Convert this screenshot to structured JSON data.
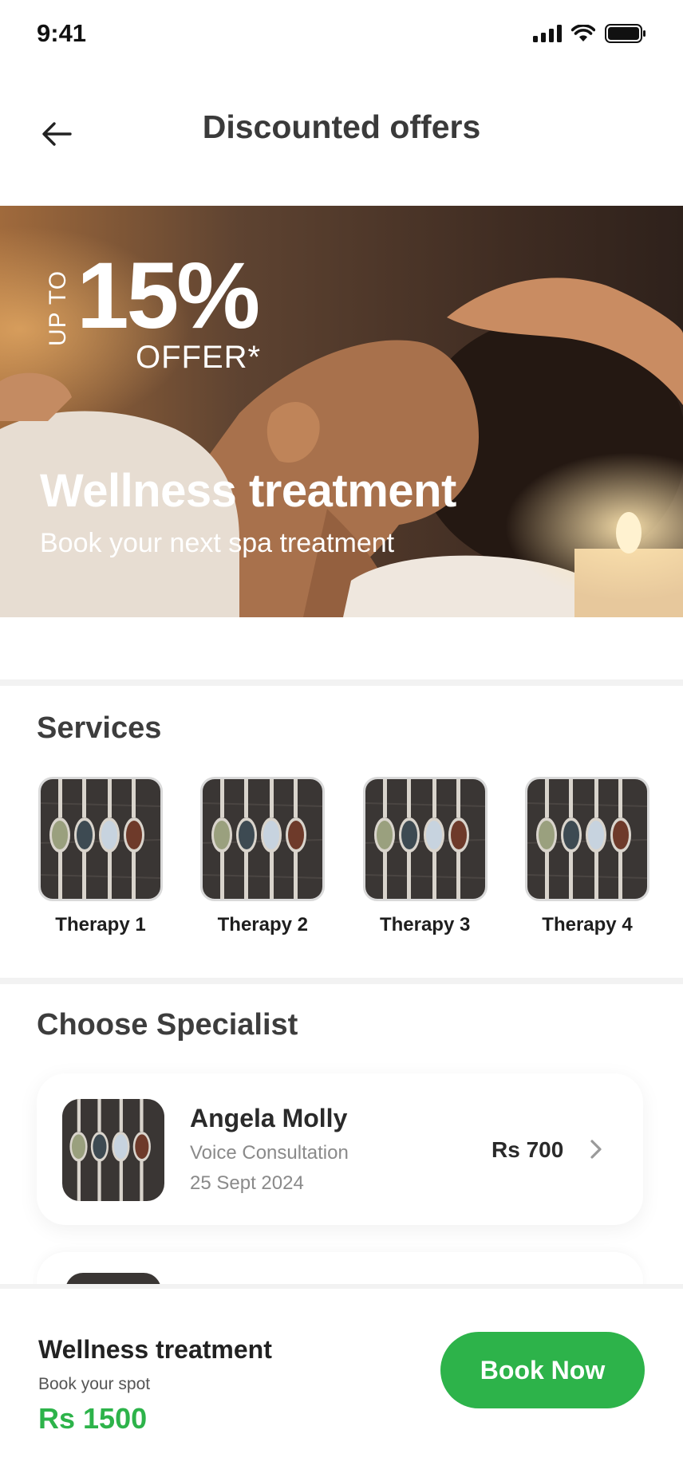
{
  "status_bar": {
    "time": "9:41"
  },
  "header": {
    "title": "Discounted offers"
  },
  "hero": {
    "promo_prefix": "UP TO",
    "promo_percent": "15%",
    "promo_suffix": "OFFER*",
    "title": "Wellness treatment",
    "subtitle": "Book your next spa treatment"
  },
  "services": {
    "title": "Services",
    "items": [
      {
        "label": "Therapy 1"
      },
      {
        "label": "Therapy 2"
      },
      {
        "label": "Therapy 3"
      },
      {
        "label": "Therapy 4"
      }
    ]
  },
  "specialists": {
    "title": "Choose Specialist",
    "items": [
      {
        "name": "Angela Molly",
        "type": "Voice Consultation",
        "date": "25 Sept 2024",
        "price": "Rs 700"
      }
    ]
  },
  "bottom_bar": {
    "title": "Wellness treatment",
    "subtitle": "Book your spot",
    "price": "Rs 1500",
    "button_label": "Book Now"
  },
  "colors": {
    "accent": "#2db34a",
    "title": "#3a3a3a",
    "muted": "#8a8a8a"
  },
  "icons": [
    "signal-icon",
    "wifi-icon",
    "battery-icon",
    "back-arrow-icon",
    "chevron-right-icon"
  ]
}
